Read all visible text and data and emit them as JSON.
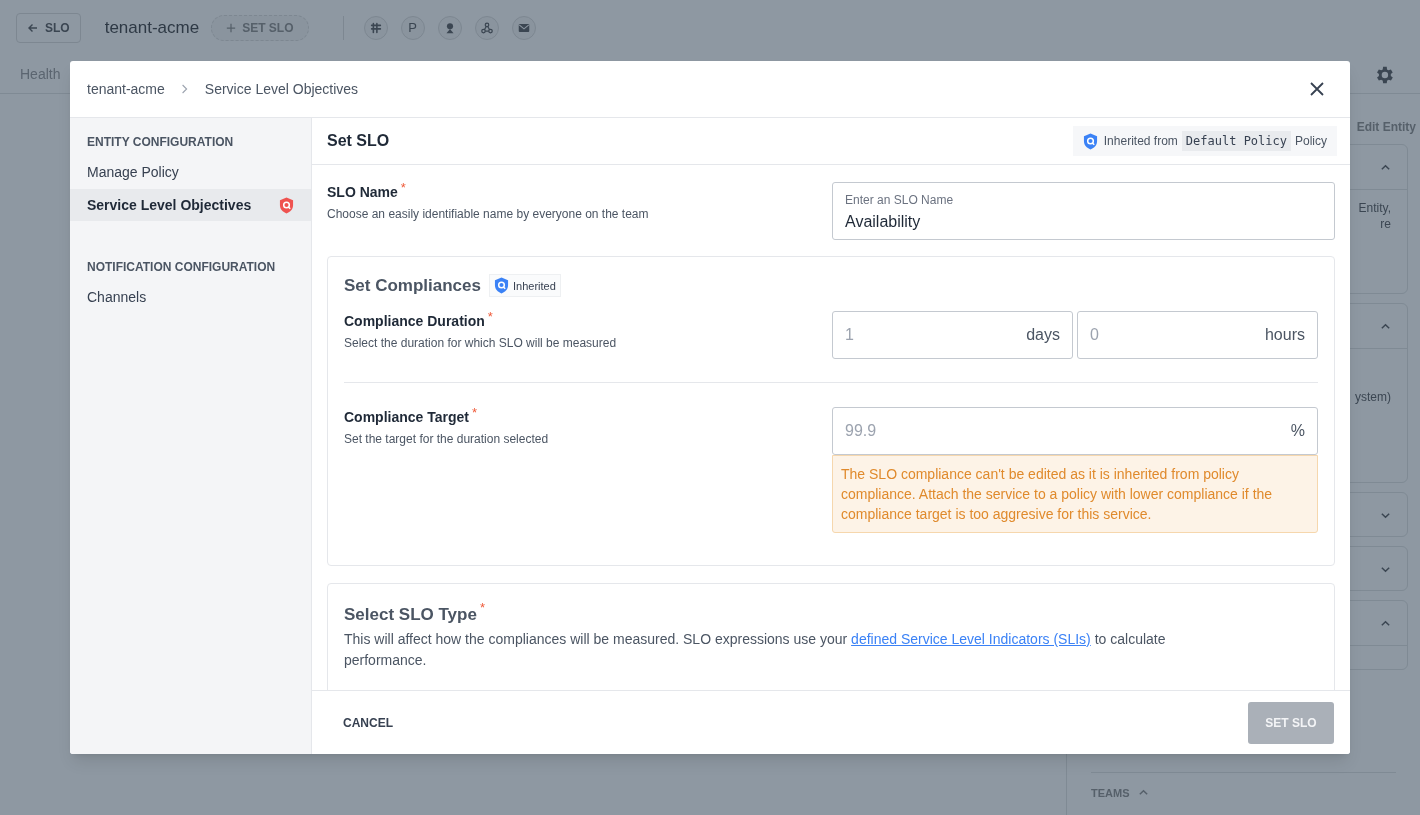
{
  "background": {
    "back_button": "SLO",
    "entity_name": "tenant-acme",
    "set_slo_button": "SET SLO",
    "integrations": [
      {
        "kind": "slack"
      },
      {
        "kind": "text",
        "label": "P"
      },
      {
        "kind": "pin"
      },
      {
        "kind": "webhook"
      },
      {
        "kind": "mail"
      }
    ],
    "tab": "Health",
    "edit_link": "Edit Entity",
    "panels": [
      {
        "expanded": true,
        "texts": [
          "Entity,",
          "re"
        ]
      },
      {
        "expanded": true,
        "texts": [
          "ystem)"
        ]
      },
      {
        "expanded": false
      },
      {
        "expanded": false
      },
      {
        "expanded": true
      }
    ],
    "section_label": "TEAMS",
    "section_expanded": true
  },
  "modal": {
    "breadcrumb": [
      "tenant-acme",
      "Service Level Objectives"
    ],
    "sidebar": [
      {
        "heading": "ENTITY CONFIGURATION",
        "items": [
          {
            "label": "Manage Policy",
            "selected": false,
            "inherited": false
          },
          {
            "label": "Service Level Objectives",
            "selected": true,
            "inherited": true
          }
        ]
      },
      {
        "heading": "NOTIFICATION CONFIGURATION",
        "items": [
          {
            "label": "Channels",
            "selected": false,
            "inherited": false
          }
        ]
      }
    ],
    "title": "Set SLO",
    "inherited_badge": {
      "prefix": "Inherited from",
      "policy": "Default Policy",
      "suffix": "Policy"
    },
    "slo_name": {
      "label": "SLO Name",
      "required_mark": "*",
      "hint": "Choose an easily identifiable name by everyone on the team",
      "placeholder": "Enter an SLO Name",
      "value": "Availability"
    },
    "compliances": {
      "title": "Set Compliances",
      "badge": "Inherited",
      "duration": {
        "label": "Compliance Duration",
        "required_mark": "*",
        "hint": "Select the duration for which SLO will be measured",
        "fields": [
          {
            "value": "1",
            "unit": "days",
            "disabled": true
          },
          {
            "value": "0",
            "unit": "hours",
            "disabled": true
          }
        ]
      },
      "target": {
        "label": "Compliance Target",
        "required_mark": "*",
        "hint": "Set the target for the duration selected",
        "value": "99.9",
        "unit": "%",
        "disabled": true,
        "warning": "The SLO compliance can't be edited as it is inherited from policy compliance. Attach the service to a policy with lower compliance if the compliance target is too aggresive for this service."
      }
    },
    "slo_type": {
      "title": "Select SLO Type",
      "required_mark": "*",
      "text_before": "This will affect how the compliances will be measured. SLO expressions use your ",
      "link": "defined Service Level Indicators (SLIs)",
      "text_after": " to calculate performance."
    },
    "footer": {
      "cancel": "CANCEL",
      "submit": {
        "label": "SET SLO",
        "disabled": true
      }
    }
  }
}
